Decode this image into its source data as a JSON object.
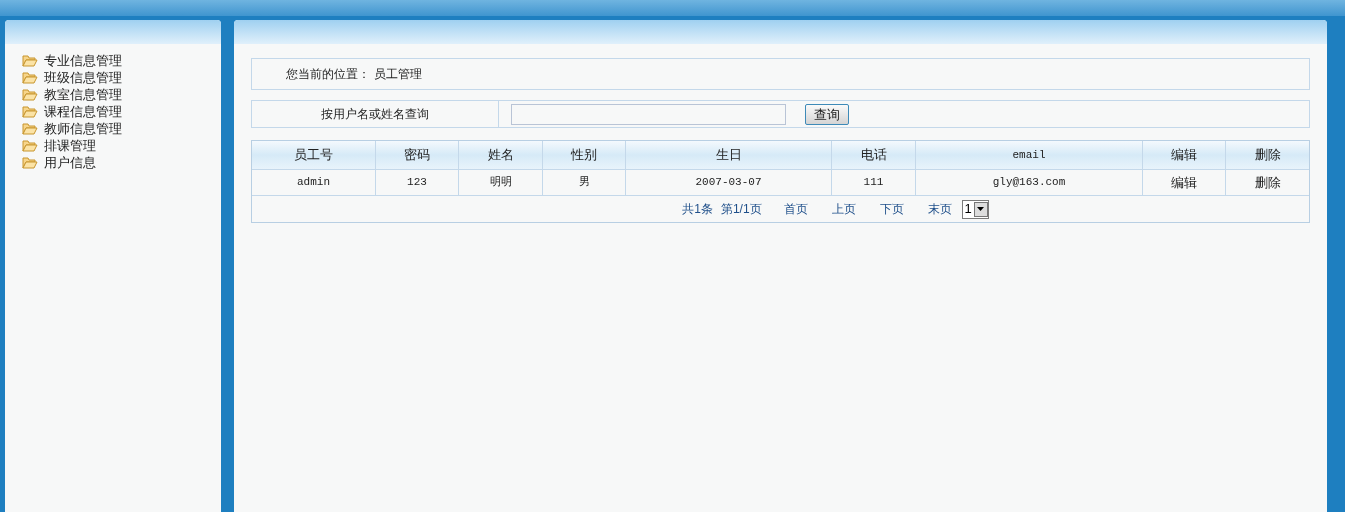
{
  "sidebar": {
    "items": [
      {
        "label": "专业信息管理"
      },
      {
        "label": "班级信息管理"
      },
      {
        "label": "教室信息管理"
      },
      {
        "label": "课程信息管理"
      },
      {
        "label": "教师信息管理"
      },
      {
        "label": "排课管理"
      },
      {
        "label": "用户信息"
      }
    ]
  },
  "breadcrumb": {
    "label": "您当前的位置：",
    "current": "员工管理"
  },
  "search": {
    "label": "按用户名或姓名查询",
    "button": "查询"
  },
  "table": {
    "columns": [
      "员工号",
      "密码",
      "姓名",
      "性别",
      "生日",
      "电话",
      "email",
      "编辑",
      "删除"
    ],
    "rows": [
      {
        "cells": [
          "admin",
          "123",
          "明明",
          "男",
          "2007-03-07",
          "111",
          "gly@163.com"
        ],
        "actions": [
          "编辑",
          "删除"
        ]
      }
    ]
  },
  "pagination": {
    "summary": [
      "共1条",
      "第1/1页"
    ],
    "links": [
      "首页",
      "上页",
      "下页",
      "末页"
    ],
    "page_select": "1"
  }
}
